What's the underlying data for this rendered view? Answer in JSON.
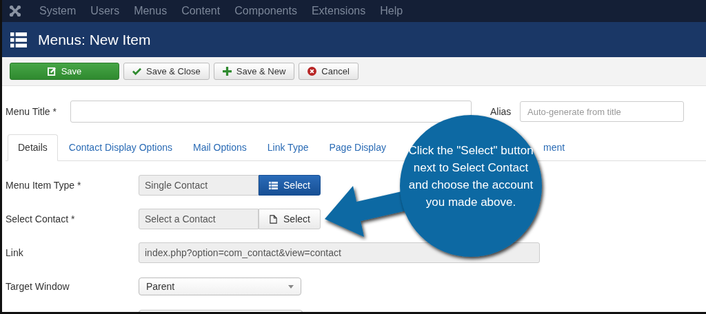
{
  "top_menu": [
    "System",
    "Users",
    "Menus",
    "Content",
    "Components",
    "Extensions",
    "Help"
  ],
  "header": {
    "title": "Menus: New Item"
  },
  "toolbar": [
    {
      "label": "Save",
      "kind": "success"
    },
    {
      "label": "Save & Close",
      "kind": "default"
    },
    {
      "label": "Save & New",
      "kind": "default"
    },
    {
      "label": "Cancel",
      "kind": "default"
    }
  ],
  "menu_title": {
    "label": "Menu Title *"
  },
  "alias": {
    "label": "Alias",
    "placeholder": "Auto-generate from title"
  },
  "tabs": [
    {
      "label": "Details",
      "selected": true
    },
    {
      "label": "Contact Display Options",
      "selected": false
    },
    {
      "label": "Mail Options",
      "selected": false
    },
    {
      "label": "Link Type",
      "selected": false
    },
    {
      "label": "Page Display",
      "selected": false
    },
    {
      "label": "ment",
      "selected": false
    }
  ],
  "fields": [
    {
      "label": "Menu Item Type *",
      "kind": "picker",
      "value": "Single Contact",
      "button": {
        "label": "Select",
        "kind": "primary"
      }
    },
    {
      "label": "Select Contact *",
      "kind": "picker",
      "value": "Select a Contact",
      "button": {
        "label": "Select",
        "kind": "default"
      }
    },
    {
      "label": "Link",
      "kind": "readonly",
      "value": "index.php?option=com_contact&view=contact"
    },
    {
      "label": "Target Window",
      "kind": "select",
      "value": "Parent"
    }
  ],
  "callout": {
    "text": "Click the \"Select\" button next to Select Contact and choose the account you made above."
  }
}
